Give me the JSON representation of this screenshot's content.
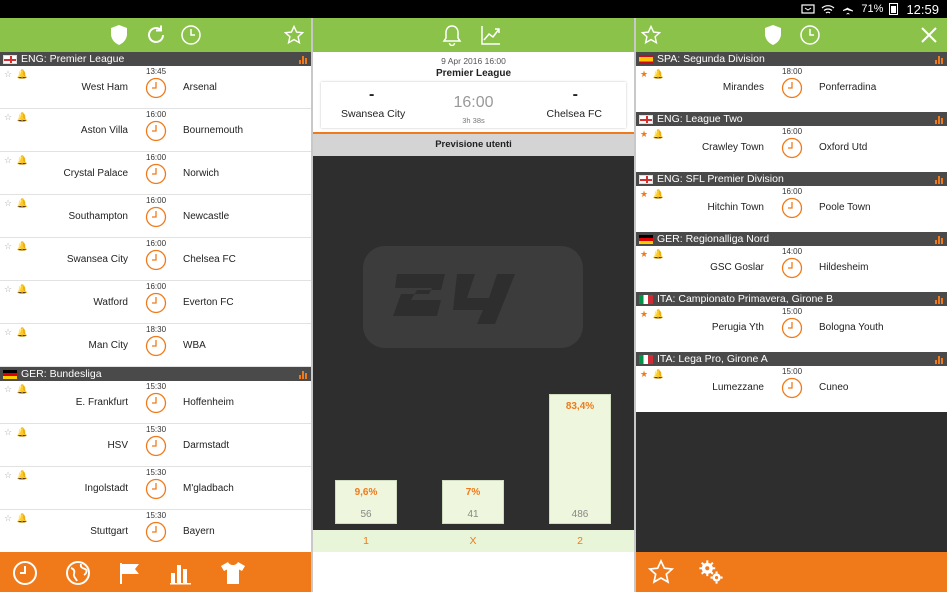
{
  "statusbar": {
    "battery": "71%",
    "time": "12:59"
  },
  "left": {
    "leagues": [
      {
        "flag": "eng",
        "name": "ENG: Premier League",
        "matches": [
          {
            "home": "West Ham",
            "away": "Arsenal",
            "time": "13:45"
          },
          {
            "home": "Aston Villa",
            "away": "Bournemouth",
            "time": "16:00"
          },
          {
            "home": "Crystal Palace",
            "away": "Norwich",
            "time": "16:00"
          },
          {
            "home": "Southampton",
            "away": "Newcastle",
            "time": "16:00"
          },
          {
            "home": "Swansea City",
            "away": "Chelsea FC",
            "time": "16:00"
          },
          {
            "home": "Watford",
            "away": "Everton FC",
            "time": "16:00"
          },
          {
            "home": "Man City",
            "away": "WBA",
            "time": "18:30"
          }
        ]
      },
      {
        "flag": "ger",
        "name": "GER: Bundesliga",
        "matches": [
          {
            "home": "E. Frankfurt",
            "away": "Hoffenheim",
            "time": "15:30"
          },
          {
            "home": "HSV",
            "away": "Darmstadt",
            "time": "15:30"
          },
          {
            "home": "Ingolstadt",
            "away": "M'gladbach",
            "time": "15:30"
          },
          {
            "home": "Stuttgart",
            "away": "Bayern",
            "time": "15:30"
          }
        ]
      }
    ]
  },
  "mid": {
    "date": "9 Apr 2016 16:00",
    "league": "Premier League",
    "home_team": "Swansea City",
    "away_team": "Chelsea FC",
    "home_score": "-",
    "away_score": "-",
    "kickoff": "16:00",
    "countdown": "3h 38s",
    "vote_title": "Previsione utenti",
    "votes": [
      {
        "label": "1",
        "pct": "9,6%",
        "count": "56",
        "value": 9.6
      },
      {
        "label": "X",
        "pct": "7%",
        "count": "41",
        "value": 7.0
      },
      {
        "label": "2",
        "pct": "83,4%",
        "count": "486",
        "value": 83.4
      }
    ]
  },
  "right": {
    "leagues": [
      {
        "flag": "spa",
        "name": "SPA: Segunda Division",
        "match": {
          "home": "Mirandes",
          "away": "Ponferradina",
          "time": "18:00"
        }
      },
      {
        "flag": "eng",
        "name": "ENG: League Two",
        "match": {
          "home": "Crawley Town",
          "away": "Oxford Utd",
          "time": "16:00"
        }
      },
      {
        "flag": "eng",
        "name": "ENG: SFL Premier Division",
        "match": {
          "home": "Hitchin Town",
          "away": "Poole Town",
          "time": "16:00"
        }
      },
      {
        "flag": "ger",
        "name": "GER: Regionalliga Nord",
        "match": {
          "home": "GSC Goslar",
          "away": "Hildesheim",
          "time": "14:00"
        }
      },
      {
        "flag": "ita",
        "name": "ITA: Campionato Primavera, Girone B",
        "match": {
          "home": "Perugia Yth",
          "away": "Bologna Youth",
          "time": "15:00"
        }
      },
      {
        "flag": "ita",
        "name": "ITA: Lega Pro, Girone A",
        "match": {
          "home": "Lumezzane",
          "away": "Cuneo",
          "time": "15:00"
        }
      }
    ]
  },
  "colors": {
    "green": "#8bc34a",
    "orange": "#f07a1a",
    "dark": "#2e2e2e",
    "header": "#4a4a4a"
  },
  "icons": [
    "shield-icon",
    "refresh-icon",
    "clock-icon",
    "star-icon",
    "bell-icon",
    "trend-icon",
    "close-icon",
    "globe-icon",
    "flag-icon",
    "bar-chart-icon",
    "shirt-icon",
    "gear-icon"
  ]
}
